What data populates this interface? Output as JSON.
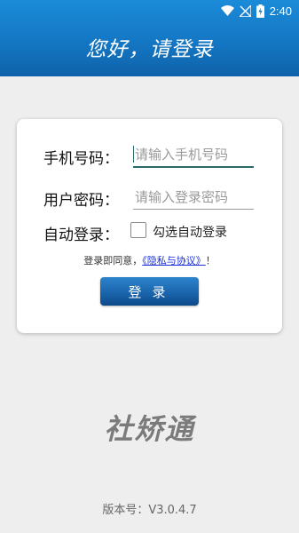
{
  "status_bar": {
    "time": "2:40"
  },
  "header": {
    "title": "您好，请登录"
  },
  "form": {
    "phone_label": "手机号码：",
    "phone_placeholder": "请输入手机号码",
    "password_label": "用户密码：",
    "password_placeholder": "请输入登录密码",
    "auto_login_label": "自动登录：",
    "auto_login_checkbox_label": "勾选自动登录",
    "auto_login_checked": false,
    "agree_prefix": "登录即同意，",
    "agree_link": "《隐私与协议》",
    "agree_suffix": "！",
    "login_button": "登录"
  },
  "brand": {
    "name": "社矫通"
  },
  "footer": {
    "version": "版本号：V3.0.4.7"
  },
  "colors": {
    "header": "#1477c4",
    "button": "#1b65ad",
    "link": "#1a2fd8",
    "background": "#eeeeee"
  }
}
